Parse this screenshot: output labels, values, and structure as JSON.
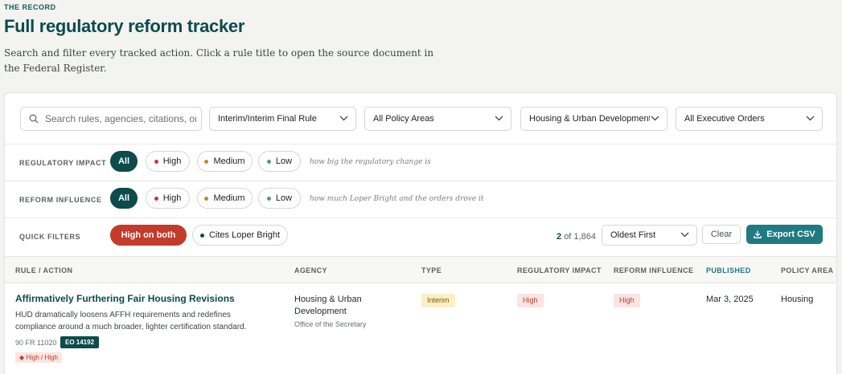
{
  "header": {
    "eyebrow": "THE RECORD",
    "title": "Full regulatory reform tracker",
    "description": "Search and filter every tracked action. Click a rule title to open the source document in the Federal Register."
  },
  "filters": {
    "search_placeholder": "Search rules, agencies, citations, or",
    "type_select": "Interim/Interim Final Rule",
    "policy_select": "All Policy Areas",
    "agency_select": "Housing & Urban Development",
    "orders_select": "All Executive Orders"
  },
  "impact_row": {
    "label": "REGULATORY IMPACT",
    "chips": [
      "All",
      "High",
      "Medium",
      "Low"
    ],
    "hint": "how big the regulatory change is"
  },
  "influence_row": {
    "label": "REFORM INFLUENCE",
    "chips": [
      "All",
      "High",
      "Medium",
      "Low"
    ],
    "hint": "how much Loper Bright and the orders drove it"
  },
  "quick_filters": {
    "label": "QUICK FILTERS",
    "high_on_both": "High on both",
    "cites_loper": "Cites Loper Bright",
    "count_shown": "2",
    "count_total": "of 1,864",
    "sort_select": "Oldest First",
    "clear_label": "Clear",
    "export_label": "Export CSV"
  },
  "table": {
    "columns": [
      "RULE / ACTION",
      "AGENCY",
      "TYPE",
      "REGULATORY IMPACT",
      "REFORM INFLUENCE",
      "PUBLISHED",
      "POLICY AREA"
    ],
    "rows": [
      {
        "title": "Affirmatively Furthering Fair Housing Revisions",
        "description": "HUD dramatically loosens AFFH requirements and redefines compliance around a much broader, lighter certification standard.",
        "citation": "90 FR 11020",
        "eo": "EO 14192",
        "combo": "◆ High / High",
        "agency": "Housing & Urban Development",
        "sub_agency": "Office of the Secretary",
        "type": "Interim",
        "impact": "High",
        "influence": "High",
        "published": "Mar 3, 2025",
        "policy_area": "Housing"
      }
    ]
  },
  "colors": {
    "brand": "#0d4b4c",
    "accent": "#1f7a82",
    "high": "#c23b2b",
    "medium": "#b8901a",
    "low": "#5f8f99"
  }
}
